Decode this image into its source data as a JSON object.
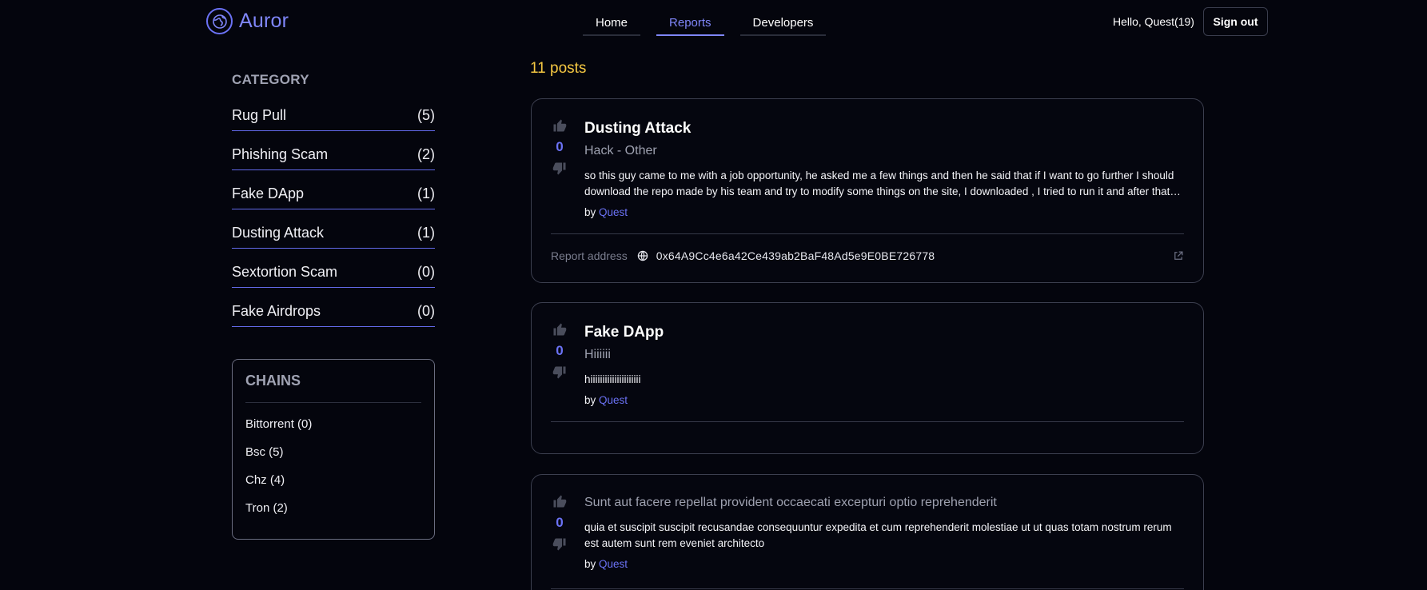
{
  "app": {
    "name": "Auror"
  },
  "nav": {
    "items": [
      "Home",
      "Reports",
      "Developers"
    ],
    "active": "Reports"
  },
  "user": {
    "greeting": "Hello, Quest(19)",
    "signout_label": "Sign out"
  },
  "sidebar": {
    "category_title": "CATEGORY",
    "categories": [
      {
        "label": "Rug Pull",
        "count": "(5)"
      },
      {
        "label": "Phishing Scam",
        "count": "(2)"
      },
      {
        "label": "Fake DApp",
        "count": "(1)"
      },
      {
        "label": "Dusting Attack",
        "count": "(1)"
      },
      {
        "label": "Sextortion Scam",
        "count": "(0)"
      },
      {
        "label": "Fake Airdrops",
        "count": "(0)"
      }
    ],
    "chains_title": "CHAINS",
    "chains": [
      "Bittorrent (0)",
      "Bsc (5)",
      "Chz (4)",
      "Tron (2)"
    ]
  },
  "main": {
    "post_count": "11 posts",
    "posts": [
      {
        "title": "Dusting Attack",
        "subtitle": "Hack - Other",
        "votes": "0",
        "text": "so this guy came to me with a job opportunity, he asked me a few things and then he said that if I want to go further I should download the repo made by his team and try to modify some things on the site, I downloaded , I tried to run it and after that my wallet was drained",
        "by_label": "by",
        "author": "Quest",
        "report_label": "Report address",
        "report_address": "0x64A9Cc4e6a42Ce439ab2BaF48Ad5e9E0BE726778"
      },
      {
        "title": "Fake DApp",
        "subtitle": "Hiiiiii",
        "votes": "0",
        "text": "hiiiiiiiiiiiiiiiiiiiii",
        "by_label": "by",
        "author": "Quest"
      },
      {
        "subtitle": "Sunt aut facere repellat provident occaecati excepturi optio reprehenderit",
        "votes": "0",
        "text": "quia et suscipit suscipit recusandae consequuntur expedita et cum reprehenderit molestiae ut ut quas totam nostrum rerum est autem sunt rem eveniet architecto",
        "by_label": "by",
        "author": "Quest"
      }
    ]
  },
  "colors": {
    "accent": "#6b72f5",
    "count_highlight": "#f5c842",
    "background": "#04050d"
  },
  "icons": [
    "globe-icon",
    "thumbs-up-icon",
    "thumbs-down-icon",
    "external-link-icon"
  ]
}
